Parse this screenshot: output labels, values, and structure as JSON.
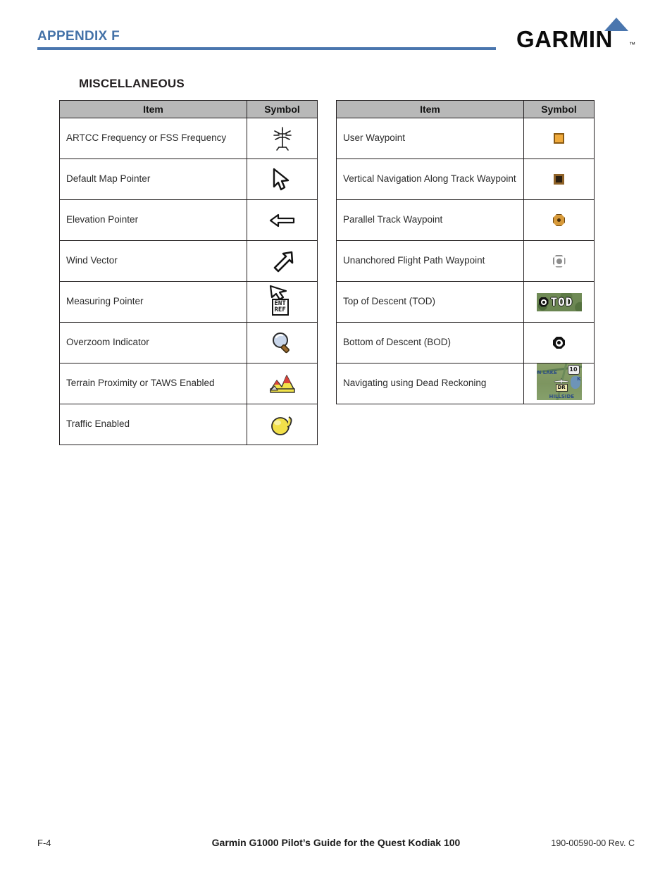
{
  "header": {
    "appendix_label": "APPENDIX F",
    "logo": {
      "wordmark": "GARMIN",
      "trademark": "™",
      "triangle_color": "#4a76ae"
    },
    "rule_color": "#4a76ae",
    "appendix_color": "#4472a8"
  },
  "section": {
    "title": "MISCELLANEOUS"
  },
  "tables": {
    "headers": {
      "item": "Item",
      "symbol": "Symbol"
    },
    "header_bg": "#b8b8b8",
    "left": {
      "rows": [
        {
          "item": "ARTCC Frequency or FSS Frequency",
          "symbol_name": "radio-tower-icon"
        },
        {
          "item": "Default Map Pointer",
          "symbol_name": "map-pointer-icon"
        },
        {
          "item": "Elevation Pointer",
          "symbol_name": "elevation-pointer-icon"
        },
        {
          "item": "Wind Vector",
          "symbol_name": "wind-vector-icon"
        },
        {
          "item": "Measuring Pointer",
          "symbol_name": "measuring-pointer-icon",
          "symbol_text": "ENT\nREF"
        },
        {
          "item": "Overzoom Indicator",
          "symbol_name": "magnifier-icon"
        },
        {
          "item": "Terrain Proximity or TAWS Enabled",
          "symbol_name": "terrain-mountain-icon"
        },
        {
          "item": "Traffic Enabled",
          "symbol_name": "traffic-balloon-icon"
        }
      ]
    },
    "right": {
      "rows": [
        {
          "item": "User Waypoint",
          "symbol_name": "user-waypoint-square-icon"
        },
        {
          "item": "Vertical Navigation Along Track Waypoint",
          "symbol_name": "vnav-along-track-square-icon"
        },
        {
          "item": "Parallel Track Waypoint",
          "symbol_name": "parallel-track-octagon-icon"
        },
        {
          "item": "Unanchored Flight Path Waypoint",
          "symbol_name": "unanchored-waypoint-ring-icon"
        },
        {
          "item": "Top of Descent (TOD)",
          "symbol_name": "top-of-descent-icon",
          "symbol_text": "TOD"
        },
        {
          "item": "Bottom of Descent (BOD)",
          "symbol_name": "bottom-of-descent-icon"
        },
        {
          "item": "Navigating using Dead Reckoning",
          "symbol_name": "dead-reckoning-map-icon",
          "symbol_text": "DR",
          "map_highway": "10",
          "map_towns": [
            "N LAKE",
            "HILLSIDE",
            "K"
          ]
        }
      ]
    }
  },
  "footer": {
    "page_number": "F-4",
    "doc_title": "Garmin G1000 Pilot’s Guide for the Quest Kodiak 100",
    "part_number": "190-00590-00  Rev. C"
  }
}
